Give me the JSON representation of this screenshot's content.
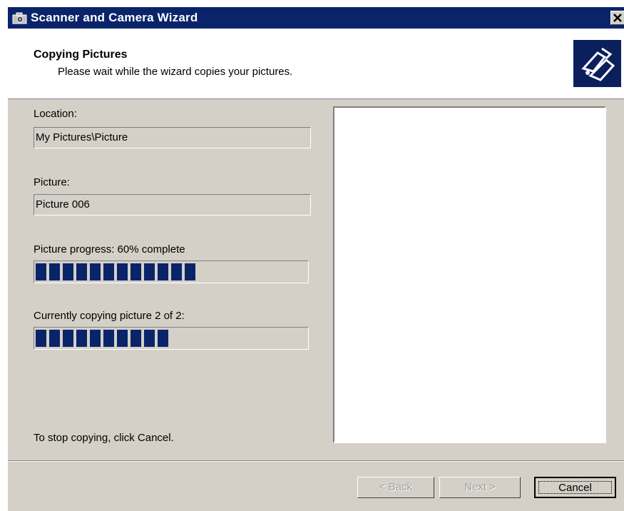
{
  "window": {
    "title": "Scanner and Camera Wizard",
    "icons": {
      "title": "camera-icon",
      "close": "close-icon",
      "logo": "wizard-logo-icon"
    }
  },
  "header": {
    "title": "Copying Pictures",
    "subtitle": "Please wait while the wizard copies your pictures."
  },
  "form": {
    "location_label": "Location:",
    "location_value": "My Pictures\\Picture",
    "picture_label": "Picture:",
    "picture_value": "Picture 006",
    "picture_progress_label": "Picture progress: 60% complete",
    "picture_progress_fraction": 0.6,
    "overall_progress_label": "Currently copying picture 2 of 2:",
    "overall_progress_fraction": 0.5,
    "stop_hint": "To stop copying, click Cancel."
  },
  "buttons": {
    "back": "< Back",
    "next": "Next >",
    "cancel": "Cancel"
  },
  "colors": {
    "titlebar": "#0a246a",
    "face": "#d4d0c8",
    "progress": "#0a246a"
  }
}
